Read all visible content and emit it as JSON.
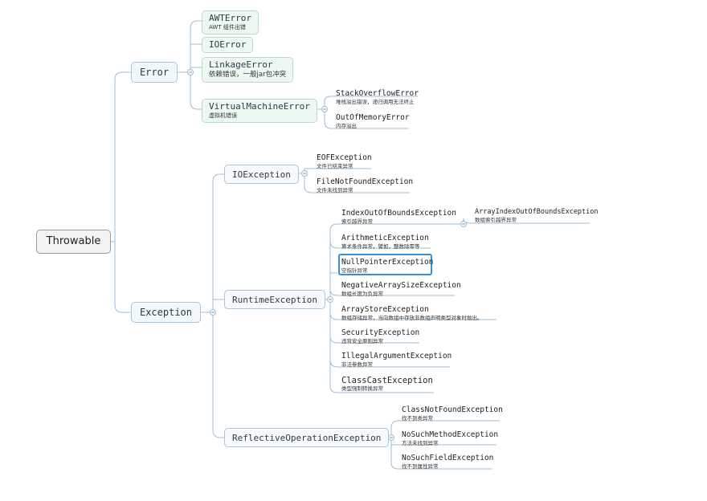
{
  "root": "Throwable",
  "error": {
    "label": "Error",
    "children": [
      {
        "title": "AWTError",
        "desc": "AWT 组件出错"
      },
      {
        "title": "IOError",
        "desc": ""
      },
      {
        "title": "LinkageError",
        "desc": "依赖错误，一般jar包冲突"
      },
      {
        "title": "VirtualMachineError",
        "desc": "虚拟机错误"
      }
    ],
    "vm_children": [
      {
        "title": "StackOverflowError",
        "desc": "堆栈溢出错误，递归调用无法终止"
      },
      {
        "title": "OutOfMemoryError",
        "desc": "内存溢出"
      }
    ]
  },
  "exception": {
    "label": "Exception",
    "io": {
      "label": "IOException",
      "children": [
        {
          "title": "EOFException",
          "desc": "文件已结束异常"
        },
        {
          "title": "FileNotFoundException",
          "desc": "文件未找到异常"
        }
      ]
    },
    "runtime": {
      "label": "RuntimeException",
      "children": [
        {
          "title": "IndexOutOfBoundsException",
          "desc": "索引越界异常"
        },
        {
          "title": "ArithmeticException",
          "desc": "算术条件异常，譬如，整数除零等"
        },
        {
          "title": "NullPointerException",
          "desc": "空指针异常"
        },
        {
          "title": "NegativeArraySizeException",
          "desc": "数组长度为负异常"
        },
        {
          "title": "ArrayStoreException",
          "desc": "数组存储异常，当向数组中存放非数组声明类型对象时抛出。"
        },
        {
          "title": "SecurityException",
          "desc": "违背安全原则异常"
        },
        {
          "title": "IllegalArgumentException",
          "desc": "非法参数异常"
        },
        {
          "title": "ClassCastException",
          "desc": "类型强制转换异常"
        }
      ],
      "index_child": {
        "title": "ArrayIndexOutOfBoundsException",
        "desc": "数组索引越界异常"
      }
    },
    "reflective": {
      "label": "ReflectiveOperationException",
      "children": [
        {
          "title": "ClassNotFoundException",
          "desc": "找不到类异常"
        },
        {
          "title": "NoSuchMethodException",
          "desc": "方法未找到异常"
        },
        {
          "title": "NoSuchFieldException",
          "desc": "找不到属性异常"
        }
      ]
    }
  }
}
